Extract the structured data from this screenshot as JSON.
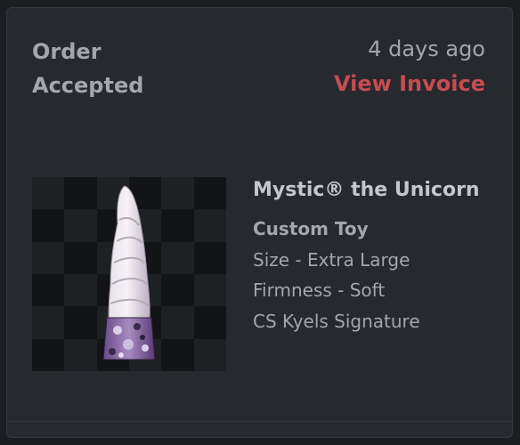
{
  "order": {
    "status_line1": "Order",
    "status_line2": "Accepted",
    "time_ago": "4 days ago",
    "view_invoice_label": "View Invoice",
    "accent_color": "#c64c52"
  },
  "product": {
    "name": "Mystic® the Unicorn",
    "type": "Custom Toy",
    "details": [
      "Size - Extra Large",
      "Firmness - Soft",
      "CS Kyels Signature"
    ],
    "image_icon": "product-thumbnail"
  }
}
